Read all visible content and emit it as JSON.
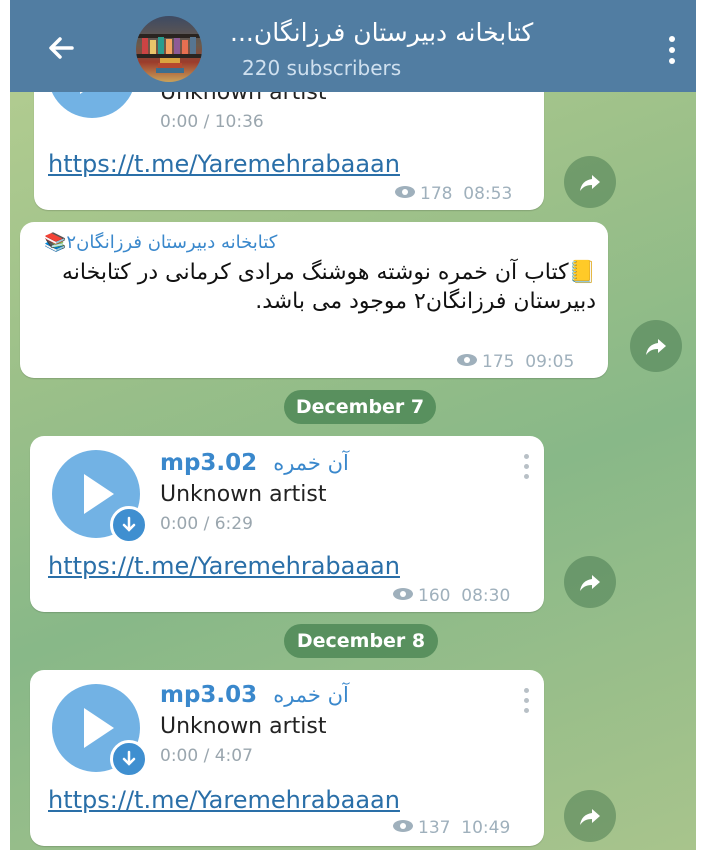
{
  "header": {
    "title": "کتابخانه دبیرستان فرزانگان...",
    "subscribers": "220 subscribers"
  },
  "messages": [
    {
      "artist": "Unknown artist",
      "duration": "0:00 / 10:36",
      "link": "https://t.me/Yaremehrabaaan",
      "views": "178",
      "time": "08:53"
    },
    {
      "forwarded_from": "کتابخانه دبیرستان فرزانگان۲📚",
      "text": "📒کتاب آن خمره نوشته هوشنگ مرادی کرمانی در کتابخانه دبیرستان فرزانگان۲ موجود می باشد.",
      "views": "175",
      "time": "09:05"
    },
    {
      "date": "December 7",
      "file_name": "mp3.02",
      "file_title_fa": "آن خمره",
      "artist": "Unknown artist",
      "duration": "0:00 / 6:29",
      "link": "https://t.me/Yaremehrabaaan",
      "views": "160",
      "time": "08:30"
    },
    {
      "date": "December 8",
      "file_name": "mp3.03",
      "file_title_fa": "آن خمره",
      "artist": "Unknown artist",
      "duration": "0:00 / 4:07",
      "link": "https://t.me/Yaremehrabaaan",
      "views": "137",
      "time": "10:49"
    }
  ],
  "icons": {
    "back": "arrow-left-icon",
    "menu": "more-vertical-icon",
    "views": "eye-icon",
    "share": "share-arrow-icon",
    "play": "play-icon",
    "download": "download-icon"
  },
  "colors": {
    "header": "#517da2",
    "link": "#2a6fa8",
    "accent": "#3a88cc",
    "play_button": "#72b2e4",
    "date_pill": "#4a8655"
  }
}
